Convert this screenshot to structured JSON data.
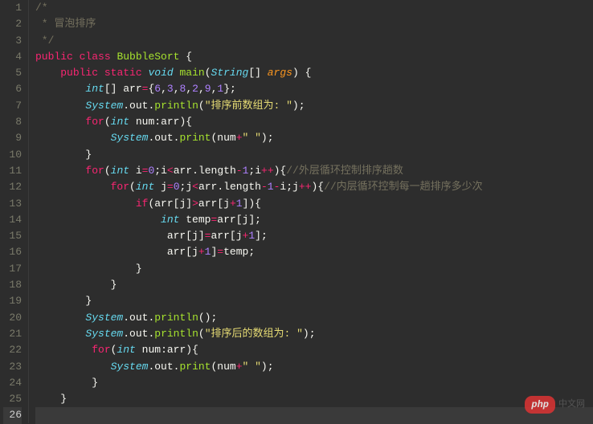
{
  "line_count": 26,
  "active_line": 26,
  "watermark": {
    "badge": "php",
    "text": "中文网"
  },
  "lines": [
    [
      [
        "comment",
        "/*"
      ]
    ],
    [
      [
        "comment",
        " * 冒泡排序"
      ]
    ],
    [
      [
        "comment",
        " */"
      ]
    ],
    [
      [
        "keyword",
        "public"
      ],
      [
        "punct",
        " "
      ],
      [
        "keyword",
        "class"
      ],
      [
        "punct",
        " "
      ],
      [
        "classname",
        "BubbleSort"
      ],
      [
        "punct",
        " {"
      ]
    ],
    [
      [
        "punct",
        "    "
      ],
      [
        "keyword",
        "public"
      ],
      [
        "punct",
        " "
      ],
      [
        "keyword",
        "static"
      ],
      [
        "punct",
        " "
      ],
      [
        "type",
        "void"
      ],
      [
        "punct",
        " "
      ],
      [
        "func",
        "main"
      ],
      [
        "punct",
        "("
      ],
      [
        "type",
        "String"
      ],
      [
        "punct",
        "[] "
      ],
      [
        "var",
        "args"
      ],
      [
        "punct",
        ") {"
      ]
    ],
    [
      [
        "punct",
        "        "
      ],
      [
        "type",
        "int"
      ],
      [
        "punct",
        "[] "
      ],
      [
        "ident",
        "arr"
      ],
      [
        "op",
        "="
      ],
      [
        "punct",
        "{"
      ],
      [
        "number",
        "6"
      ],
      [
        "punct",
        ","
      ],
      [
        "number",
        "3"
      ],
      [
        "punct",
        ","
      ],
      [
        "number",
        "8"
      ],
      [
        "punct",
        ","
      ],
      [
        "number",
        "2"
      ],
      [
        "punct",
        ","
      ],
      [
        "number",
        "9"
      ],
      [
        "punct",
        ","
      ],
      [
        "number",
        "1"
      ],
      [
        "punct",
        "};"
      ]
    ],
    [
      [
        "punct",
        "        "
      ],
      [
        "type",
        "System"
      ],
      [
        "punct",
        "."
      ],
      [
        "ident",
        "out"
      ],
      [
        "punct",
        "."
      ],
      [
        "func",
        "println"
      ],
      [
        "punct",
        "("
      ],
      [
        "string",
        "\"排序前数组为: \""
      ],
      [
        "punct",
        ");"
      ]
    ],
    [
      [
        "punct",
        "        "
      ],
      [
        "keyword",
        "for"
      ],
      [
        "punct",
        "("
      ],
      [
        "type",
        "int"
      ],
      [
        "punct",
        " "
      ],
      [
        "ident",
        "num"
      ],
      [
        "punct",
        ":"
      ],
      [
        "ident",
        "arr"
      ],
      [
        "punct",
        "){"
      ]
    ],
    [
      [
        "punct",
        "            "
      ],
      [
        "type",
        "System"
      ],
      [
        "punct",
        "."
      ],
      [
        "ident",
        "out"
      ],
      [
        "punct",
        "."
      ],
      [
        "func",
        "print"
      ],
      [
        "punct",
        "("
      ],
      [
        "ident",
        "num"
      ],
      [
        "op",
        "+"
      ],
      [
        "string",
        "\" \""
      ],
      [
        "punct",
        ");"
      ]
    ],
    [
      [
        "punct",
        "        }"
      ]
    ],
    [
      [
        "punct",
        "        "
      ],
      [
        "keyword",
        "for"
      ],
      [
        "punct",
        "("
      ],
      [
        "type",
        "int"
      ],
      [
        "punct",
        " "
      ],
      [
        "ident",
        "i"
      ],
      [
        "op",
        "="
      ],
      [
        "number",
        "0"
      ],
      [
        "punct",
        ";"
      ],
      [
        "ident",
        "i"
      ],
      [
        "op",
        "<"
      ],
      [
        "ident",
        "arr"
      ],
      [
        "punct",
        "."
      ],
      [
        "ident",
        "length"
      ],
      [
        "op",
        "-"
      ],
      [
        "number",
        "1"
      ],
      [
        "punct",
        ";"
      ],
      [
        "ident",
        "i"
      ],
      [
        "op",
        "++"
      ],
      [
        "punct",
        "){"
      ],
      [
        "comment",
        "//外层循环控制排序趟数"
      ]
    ],
    [
      [
        "punct",
        "            "
      ],
      [
        "keyword",
        "for"
      ],
      [
        "punct",
        "("
      ],
      [
        "type",
        "int"
      ],
      [
        "punct",
        " "
      ],
      [
        "ident",
        "j"
      ],
      [
        "op",
        "="
      ],
      [
        "number",
        "0"
      ],
      [
        "punct",
        ";"
      ],
      [
        "ident",
        "j"
      ],
      [
        "op",
        "<"
      ],
      [
        "ident",
        "arr"
      ],
      [
        "punct",
        "."
      ],
      [
        "ident",
        "length"
      ],
      [
        "op",
        "-"
      ],
      [
        "number",
        "1"
      ],
      [
        "op",
        "-"
      ],
      [
        "ident",
        "i"
      ],
      [
        "punct",
        ";"
      ],
      [
        "ident",
        "j"
      ],
      [
        "op",
        "++"
      ],
      [
        "punct",
        "){"
      ],
      [
        "comment",
        "//内层循环控制每一趟排序多少次"
      ]
    ],
    [
      [
        "punct",
        "                "
      ],
      [
        "keyword",
        "if"
      ],
      [
        "punct",
        "("
      ],
      [
        "ident",
        "arr"
      ],
      [
        "punct",
        "["
      ],
      [
        "ident",
        "j"
      ],
      [
        "punct",
        "]"
      ],
      [
        "op",
        ">"
      ],
      [
        "ident",
        "arr"
      ],
      [
        "punct",
        "["
      ],
      [
        "ident",
        "j"
      ],
      [
        "op",
        "+"
      ],
      [
        "number",
        "1"
      ],
      [
        "punct",
        "]){"
      ]
    ],
    [
      [
        "punct",
        "                    "
      ],
      [
        "type",
        "int"
      ],
      [
        "punct",
        " "
      ],
      [
        "ident",
        "temp"
      ],
      [
        "op",
        "="
      ],
      [
        "ident",
        "arr"
      ],
      [
        "punct",
        "["
      ],
      [
        "ident",
        "j"
      ],
      [
        "punct",
        "];"
      ]
    ],
    [
      [
        "punct",
        "                     "
      ],
      [
        "ident",
        "arr"
      ],
      [
        "punct",
        "["
      ],
      [
        "ident",
        "j"
      ],
      [
        "punct",
        "]"
      ],
      [
        "op",
        "="
      ],
      [
        "ident",
        "arr"
      ],
      [
        "punct",
        "["
      ],
      [
        "ident",
        "j"
      ],
      [
        "op",
        "+"
      ],
      [
        "number",
        "1"
      ],
      [
        "punct",
        "];"
      ]
    ],
    [
      [
        "punct",
        "                     "
      ],
      [
        "ident",
        "arr"
      ],
      [
        "punct",
        "["
      ],
      [
        "ident",
        "j"
      ],
      [
        "op",
        "+"
      ],
      [
        "number",
        "1"
      ],
      [
        "punct",
        "]"
      ],
      [
        "op",
        "="
      ],
      [
        "ident",
        "temp"
      ],
      [
        "punct",
        ";"
      ]
    ],
    [
      [
        "punct",
        "                }"
      ]
    ],
    [
      [
        "punct",
        "            }"
      ]
    ],
    [
      [
        "punct",
        "        }"
      ]
    ],
    [
      [
        "punct",
        "        "
      ],
      [
        "type",
        "System"
      ],
      [
        "punct",
        "."
      ],
      [
        "ident",
        "out"
      ],
      [
        "punct",
        "."
      ],
      [
        "func",
        "println"
      ],
      [
        "punct",
        "();"
      ]
    ],
    [
      [
        "punct",
        "        "
      ],
      [
        "type",
        "System"
      ],
      [
        "punct",
        "."
      ],
      [
        "ident",
        "out"
      ],
      [
        "punct",
        "."
      ],
      [
        "func",
        "println"
      ],
      [
        "punct",
        "("
      ],
      [
        "string",
        "\"排序后的数组为: \""
      ],
      [
        "punct",
        ");"
      ]
    ],
    [
      [
        "punct",
        "         "
      ],
      [
        "keyword",
        "for"
      ],
      [
        "punct",
        "("
      ],
      [
        "type",
        "int"
      ],
      [
        "punct",
        " "
      ],
      [
        "ident",
        "num"
      ],
      [
        "punct",
        ":"
      ],
      [
        "ident",
        "arr"
      ],
      [
        "punct",
        "){"
      ]
    ],
    [
      [
        "punct",
        "            "
      ],
      [
        "type",
        "System"
      ],
      [
        "punct",
        "."
      ],
      [
        "ident",
        "out"
      ],
      [
        "punct",
        "."
      ],
      [
        "func",
        "print"
      ],
      [
        "punct",
        "("
      ],
      [
        "ident",
        "num"
      ],
      [
        "op",
        "+"
      ],
      [
        "string",
        "\" \""
      ],
      [
        "punct",
        ");"
      ]
    ],
    [
      [
        "punct",
        "         }"
      ]
    ],
    [
      [
        "punct",
        "    }"
      ]
    ],
    [
      [
        "punct",
        ""
      ]
    ]
  ]
}
